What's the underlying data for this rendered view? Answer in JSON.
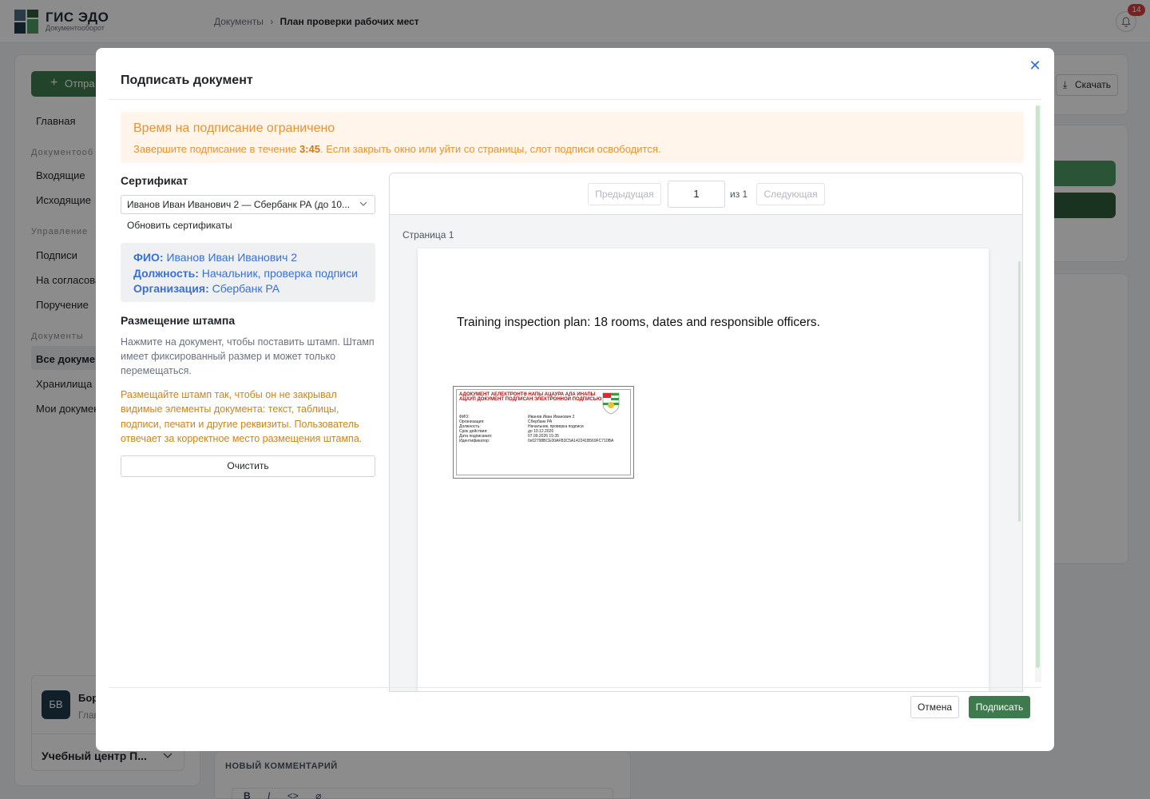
{
  "app": {
    "title": "ГИС ЭДО",
    "subtitle": "Документооборот",
    "notifications_count": "14"
  },
  "breadcrumb": {
    "parent": "Документы",
    "separator": "›",
    "current": "План проверки рабочих мест"
  },
  "sidebar": {
    "send_label": "Отпра",
    "items": [
      {
        "label": "Главная"
      },
      {
        "label": "Входящие"
      },
      {
        "label": "Исходящие"
      },
      {
        "label": "Подписи"
      },
      {
        "label": "На согласова"
      },
      {
        "label": "Поручение"
      },
      {
        "label": "Все докумен"
      },
      {
        "label": "Хранилища"
      },
      {
        "label": "Мои докумен"
      }
    ],
    "sections": [
      "Документооб",
      "Управление",
      "Документы"
    ],
    "user": {
      "initials": "БВ",
      "name": "Бор",
      "role": "Глав"
    },
    "org": "Учебный центр П..."
  },
  "background": {
    "download_label": "Скачать",
    "comment_title": "НОВЫЙ КОММЕНТАРИЙ",
    "comment_tools": [
      "B",
      "I",
      "<>",
      "⌀"
    ]
  },
  "modal": {
    "title": "Подписать документ",
    "warning": {
      "title": "Время на подписание ограничено",
      "text_before": "Завершите подписание в течение ",
      "time": "3:45",
      "text_after": ". Если закрыть окно или уйти со страницы, слот подписи освободится."
    },
    "certificate": {
      "section_title": "Сертификат",
      "selected": "Иванов Иван Иванович 2 — Сбербанк РА (до 10...",
      "refresh_label": "Обновить сертификаты",
      "fio_label": "ФИО:",
      "fio": "Иванов Иван Иванович 2",
      "position_label": "Должность:",
      "position": "Начальник, проверка подписи",
      "org_label": "Организация:",
      "org": "Сбербанк РА"
    },
    "stamp_placement": {
      "section_title": "Размещение штампа",
      "hint": "Нажмите на документ, чтобы поставить штамп. Штамп имеет фиксированный размер и может только перемещаться.",
      "warning": "Размещайте штамп так, чтобы он не закрывал видимые элементы документа: текст, таблицы, подписи, печати и другие реквизиты. Пользователь отвечает за корректное место размещения штампа.",
      "clear_label": "Очистить"
    },
    "viewer": {
      "prev_label": "Предыдущая",
      "page_value": "1",
      "of_label": "из 1",
      "next_label": "Следующая",
      "page_caption": "Страница 1",
      "document_text": "Training inspection plan: 18 rooms, dates and responsible officers."
    },
    "stamp": {
      "header": "АДОКУМЕНТ АЕЛЕКТРОНТӘ НАПЫ АЦАУРА АЛА ИНАПЫ АЦАУП ДОКУМЕНТ ПОДПИСАН ЭЛЕКТРОННОЙ ПОДПИСЬЮ",
      "rows": [
        {
          "k": "ФИО:",
          "v": "Иванов Иван Иванович 2"
        },
        {
          "k": "Организация:",
          "v": "Сбербанк РА"
        },
        {
          "k": "Должность:",
          "v": "Начальник, проверка подписи"
        },
        {
          "k": "Срок действия:",
          "v": "до 10.12.2026"
        },
        {
          "k": "Дата подписания:",
          "v": "07.09.2026 15:35"
        },
        {
          "k": "Идентификатор:",
          "v": "0x02798BCE00AFB3C5A142241B569FC710BA"
        }
      ]
    },
    "cancel_label": "Отмена",
    "sign_label": "Подписать"
  }
}
